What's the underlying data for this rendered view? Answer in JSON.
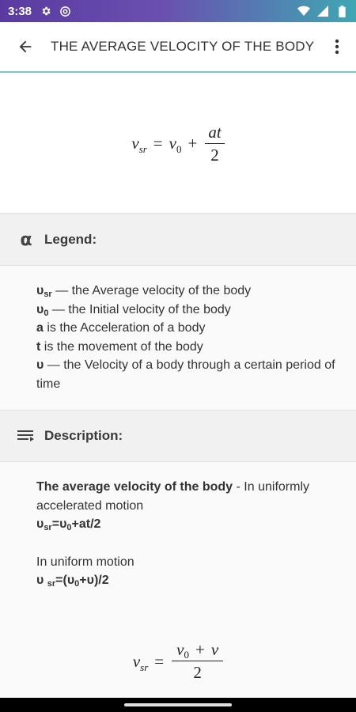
{
  "status_bar": {
    "time": "3:38",
    "left_icons": [
      "gear-icon",
      "at-icon"
    ],
    "right_icons": [
      "wifi-icon",
      "signal-icon",
      "battery-icon"
    ]
  },
  "toolbar": {
    "title": "THE AVERAGE VELOCITY OF THE BODY"
  },
  "formula_top": {
    "lhs": "v",
    "lhs_sub": "sr",
    "eq": "=",
    "term": "v",
    "term_sub": "0",
    "plus": "+",
    "numerator": "at",
    "denominator": "2"
  },
  "legend": {
    "title": "Legend:",
    "icon_glyph": "α",
    "items": [
      {
        "symbol": "υ",
        "sub": "sr",
        "text": " — the Average velocity of the body"
      },
      {
        "symbol": "υ",
        "sub": "0",
        "text": " — the Initial velocity of the body"
      },
      {
        "symbol": "a",
        "sub": "",
        "text": " is the Acceleration of a body"
      },
      {
        "symbol": "t",
        "sub": "",
        "text": " is the movement of the body"
      },
      {
        "symbol": "υ",
        "sub": "",
        "text": " — the Velocity of a body through a certain period of time"
      }
    ]
  },
  "description": {
    "title": "Description:",
    "bold_lead": "The average velocity of the body",
    "lead_rest": " - In uniformly accelerated motion",
    "formula1": {
      "a": "υ",
      "a_sub": "sr",
      "b": "=υ",
      "b_sub": "0",
      "c": "+at/2"
    },
    "uniform_text": "In uniform motion",
    "formula2": {
      "a": "υ ",
      "a_sub": "sr",
      "b": "=(υ",
      "b_sub": "0",
      "c": "+υ)/2"
    }
  },
  "formula_bottom": {
    "lhs": "v",
    "lhs_sub": "sr",
    "eq": "=",
    "numerator": "v",
    "numerator_sub": "0",
    "numerator_plus": "+",
    "numerator_v": "v",
    "denominator": "2"
  },
  "colors": {
    "status_gradient_start": "#5a3aa0",
    "status_gradient_end": "#3fa7b3",
    "toolbar_divider": "#7fc6c9"
  }
}
